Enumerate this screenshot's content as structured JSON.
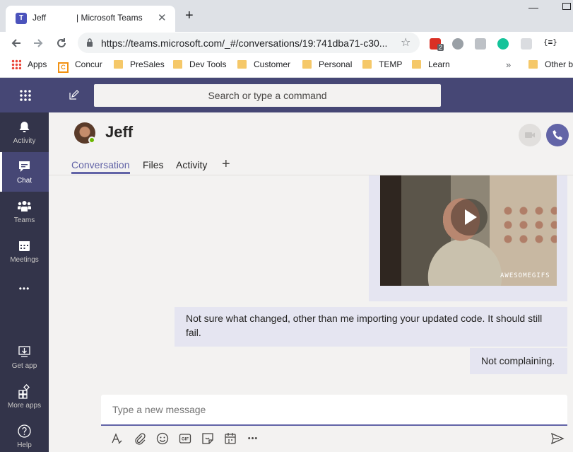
{
  "browser": {
    "tab_title_a": "Jeff",
    "tab_title_b": "| Microsoft Teams",
    "tab_close": "✕",
    "new_tab": "+",
    "url": "https://teams.microsoft.com/_#/conversations/19:741dba71-c30...",
    "ext_badge": "2",
    "ext_bracket": "{≡}",
    "bookmarks": [
      "Apps",
      "Concur",
      "PreSales",
      "Dev Tools",
      "Customer",
      "Personal",
      "TEMP",
      "Learn"
    ],
    "more": "»",
    "other_bookmarks": "Other b"
  },
  "teams": {
    "search_placeholder": "Search or type a command",
    "rail": [
      {
        "label": "Activity"
      },
      {
        "label": "Chat"
      },
      {
        "label": "Teams"
      },
      {
        "label": "Meetings"
      },
      {
        "label": "Get app"
      },
      {
        "label": "More apps"
      },
      {
        "label": "Help"
      }
    ],
    "more_dots": "•••",
    "chat": {
      "name": "Jeff",
      "tabs": [
        "Conversation",
        "Files",
        "Activity"
      ],
      "tab_add": "+"
    },
    "gif_watermark": "AWESOMEGIFS",
    "messages": [
      "Not sure what changed, other than me importing your updated code. It should still fail.",
      "Not complaining."
    ],
    "compose_placeholder": "Type a new message",
    "more_options": "•••",
    "gif_label": "GIF",
    "colors": {
      "header": "#464775",
      "rail": "#33344a",
      "accent": "#6264a7",
      "bubble": "#e5e5f1"
    }
  }
}
